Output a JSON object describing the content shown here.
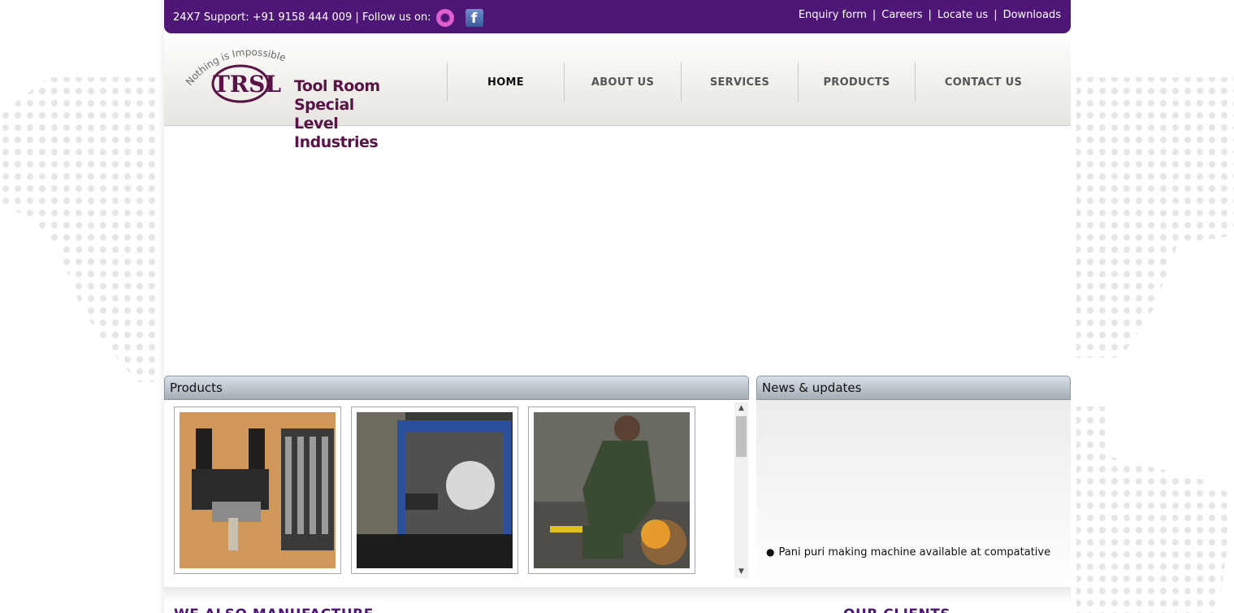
{
  "topbar": {
    "support": "24X7 Support: +91 9158 444 009 | Follow us on:",
    "social_icons": [
      "ring-icon",
      "facebook-icon"
    ],
    "links": [
      "Enquiry form",
      "Careers",
      "Locate us",
      "Downloads"
    ],
    "separator": "|"
  },
  "logo": {
    "tagline": "Nothing is Impossible",
    "mark": "TRSL",
    "name_line1": "Tool Room Special",
    "name_line2": "Level Industries"
  },
  "nav": {
    "items": [
      "HOME",
      "ABOUT US",
      "SERVICES",
      "PRODUCTS",
      "CONTACT US"
    ],
    "active": "HOME"
  },
  "products": {
    "title": "Products",
    "images": [
      "product-image-fixture",
      "product-image-machine",
      "product-image-grinding-worker"
    ]
  },
  "news": {
    "title": "News & updates",
    "items": [
      "Pani puri making machine available at compatative"
    ]
  },
  "sections": {
    "left_title": "WE ALSO MANUFACTURE",
    "right_title": "OUR CLIENTS"
  },
  "colors": {
    "brand_purple": "#4e1677",
    "logo_maroon": "#5a1346",
    "panel_head": "#a4adb6"
  }
}
